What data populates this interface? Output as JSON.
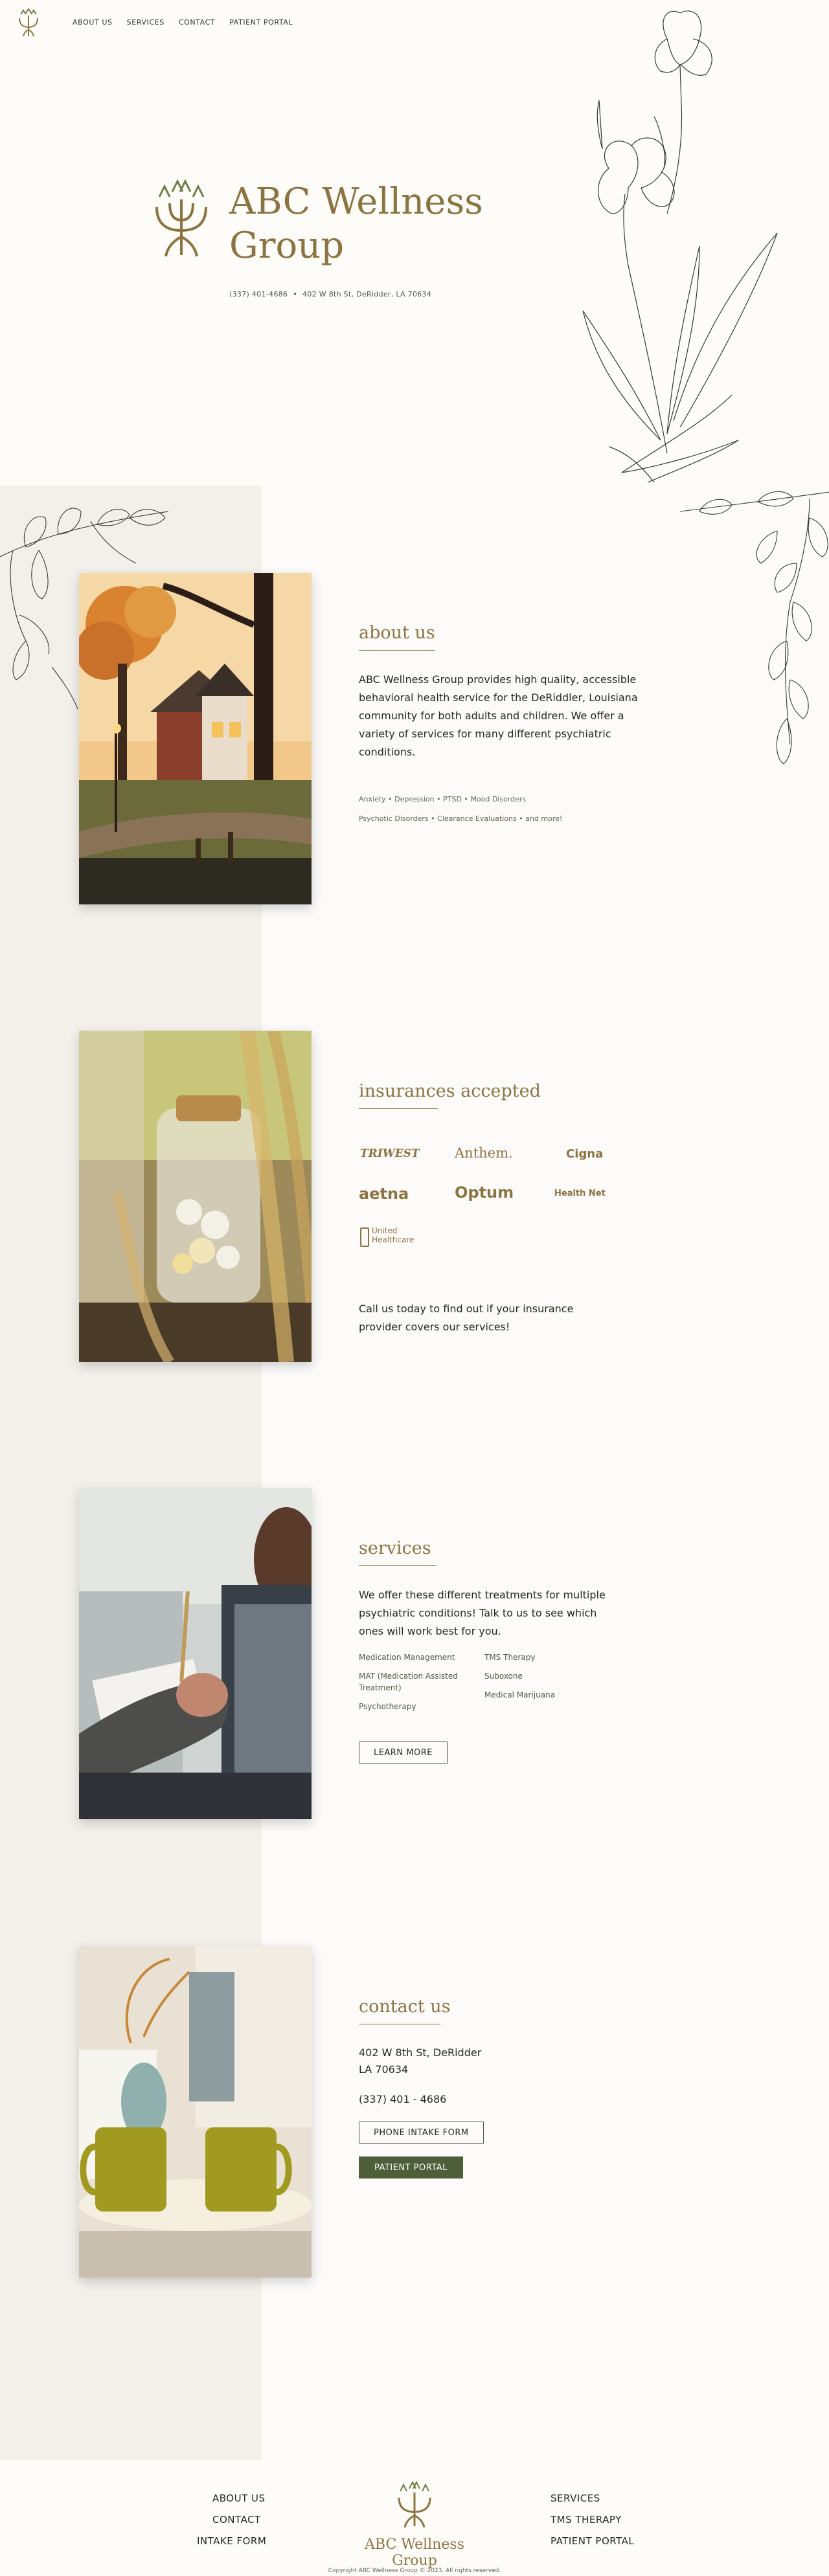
{
  "nav": {
    "items": [
      "ABOUT US",
      "SERVICES",
      "CONTACT",
      "PATIENT PORTAL"
    ]
  },
  "hero": {
    "title": "ABC Wellness Group",
    "phone": "(337) 401-4686",
    "separator": "•",
    "address": "402 W 8th St, DeRidder, LA 70634"
  },
  "about": {
    "title": "about us",
    "text": "ABC Wellness Group provides high quality, accessible behavioral health service for the DeRiddler, Louisiana community for both adults and children. We offer a variety of services for many different psychiatric conditions.",
    "tags_line1": "Anxiety  •  Depression  •  PTSD  •  Mood Disorders",
    "tags_line2": "Psychotic Disorders  •  Clearance Evaluations  •  and more!"
  },
  "insurance": {
    "title": "insurances accepted",
    "logos": [
      "TRIWEST",
      "Anthem.",
      "Cigna",
      "aetna",
      "Optum",
      "Health Net",
      "United Healthcare"
    ],
    "text": "Call us today to find out if your insurance provider covers our services!"
  },
  "services": {
    "title": "services",
    "text": "We offer these different treatments for multiple psychiatric conditions! Talk to us to see which ones will work best for you.",
    "col1": [
      "Medication Management",
      "MAT (Medication Assisted Treatment)",
      "Psychotherapy"
    ],
    "col2": [
      "TMS Therapy",
      "Suboxone",
      "Medical Marijuana"
    ],
    "button": "LEARN MORE"
  },
  "contact": {
    "title": "contact us",
    "address_line1": "402 W 8th St, DeRidder",
    "address_line2": "LA 70634",
    "phone": "(337) 401 - 4686",
    "intake_button": "PHONE INTAKE FORM",
    "portal_button": "PATIENT PORTAL"
  },
  "footer": {
    "left": [
      "ABOUT US",
      "CONTACT",
      "INTAKE FORM"
    ],
    "right": [
      "SERVICES",
      "TMS THERAPY",
      "PATIENT PORTAL"
    ],
    "brand": "ABC Wellness Group",
    "copyright": "Copyright ABC Wellness Group © 2023. All rights reserved."
  },
  "colors": {
    "accent": "#8c7441",
    "button_green": "#4e5e38",
    "band": "#f3f0eb",
    "background": "#fcfbf9"
  },
  "icons": [
    "abc-logo-icon",
    "iris-flower-illustration",
    "leaf-branch-illustration"
  ]
}
